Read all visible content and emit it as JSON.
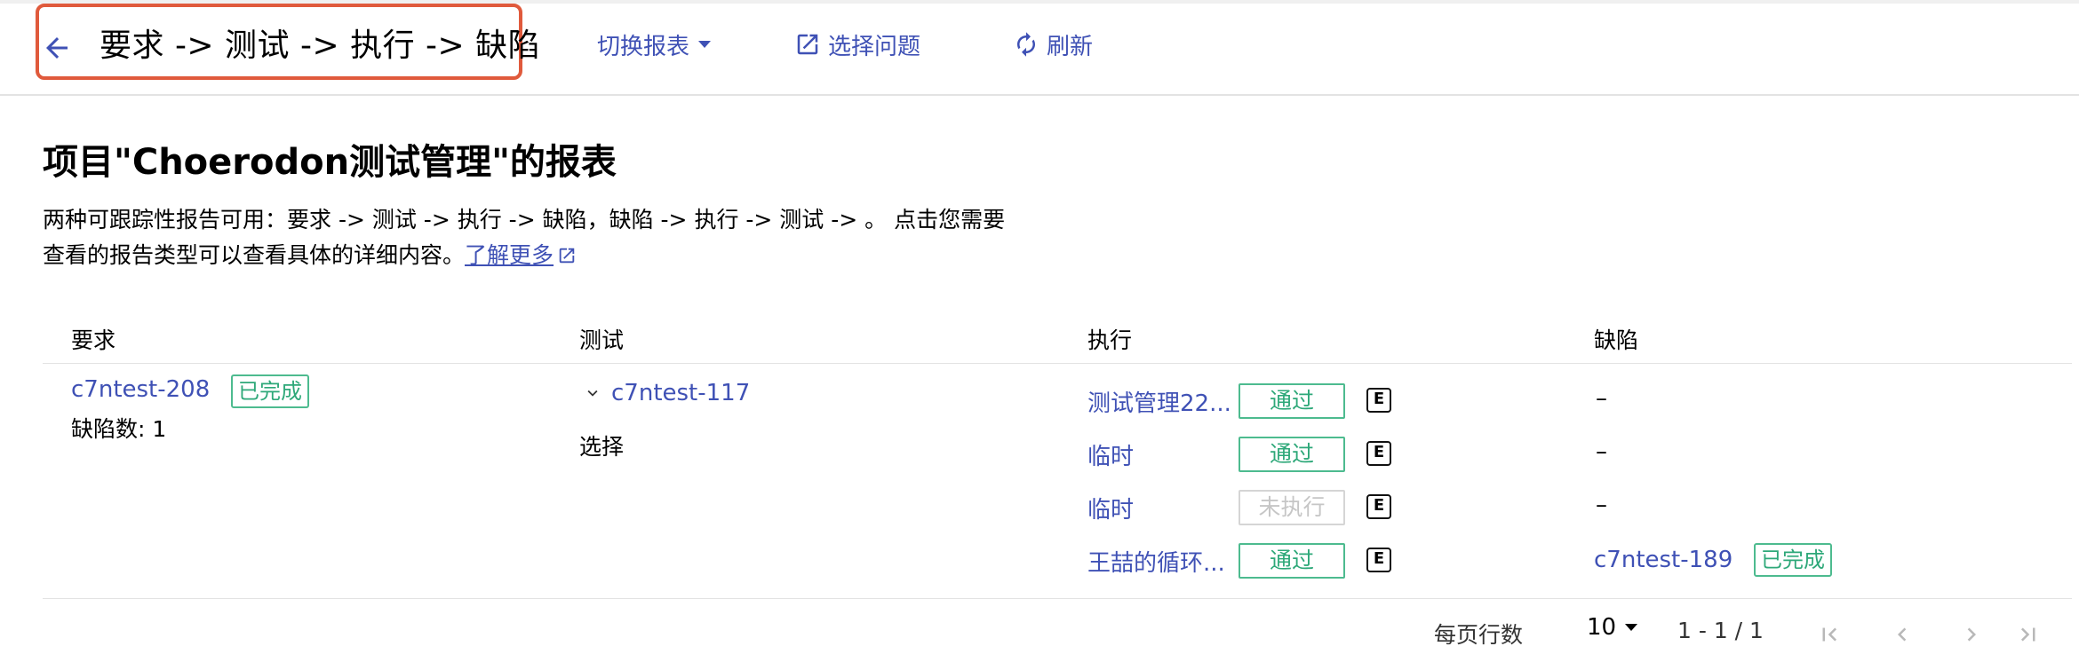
{
  "topbar": {
    "page_title": "要求 -> 测试 -> 执行 -> 缺陷",
    "switch_report": "切换报表",
    "select_issue": "选择问题",
    "refresh": "刷新"
  },
  "heading": "项目\"Choerodon测试管理\"的报表",
  "description": {
    "text": "两种可跟踪性报告可用：要求 -> 测试 -> 执行 -> 缺陷，缺陷 -> 执行 -> 测试 -> 。 点击您需要查看的报告类型可以查看具体的详细内容。",
    "learn_more": "了解更多"
  },
  "table": {
    "headers": [
      "要求",
      "测试",
      "执行",
      "缺陷"
    ],
    "requirement": {
      "id": "c7ntest-208",
      "status": "已完成",
      "defect_count_label": "缺陷数: 1"
    },
    "test": {
      "id": "c7ntest-117",
      "sub_label": "选择"
    },
    "executions": [
      {
        "name": "测试管理22...",
        "status": "通过",
        "state": "pass",
        "defect": "–",
        "defect_status": ""
      },
      {
        "name": "临时",
        "status": "通过",
        "state": "pass",
        "defect": "–",
        "defect_status": ""
      },
      {
        "name": "临时",
        "status": "未执行",
        "state": "pending",
        "defect": "–",
        "defect_status": ""
      },
      {
        "name": "王喆的循环...",
        "status": "通过",
        "state": "pass",
        "defect": "c7ntest-189",
        "defect_status": "已完成"
      }
    ],
    "e_icon_letter": "E"
  },
  "pagination": {
    "rows_per_page_label": "每页行数",
    "rows_per_page": "10",
    "range": "1 - 1 / 1"
  },
  "colors": {
    "accent": "#3f51b5",
    "success": "#2ea879",
    "highlight_border": "#e05a3c"
  }
}
